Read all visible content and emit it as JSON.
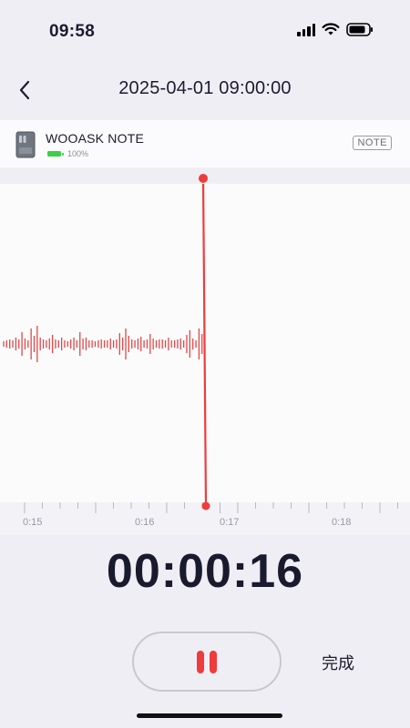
{
  "status_bar": {
    "time": "09:58",
    "signal_icon": "signal-bars-icon",
    "wifi_icon": "wifi-icon",
    "battery_icon": "battery-icon"
  },
  "nav": {
    "back_icon": "chevron-left-icon",
    "title": "2025-04-01 09:00:00"
  },
  "device": {
    "icon": "recorder-device-icon",
    "name": "WOOASK NOTE",
    "battery_percent": "100%",
    "badge": "NOTE"
  },
  "timeline": {
    "labels": [
      "0:15",
      "0:16",
      "0:17",
      "0:18"
    ]
  },
  "timer": "00:00:16",
  "controls": {
    "pause_icon": "pause-icon",
    "done_label": "完成"
  },
  "colors": {
    "accent_red": "#ef3b3b",
    "waveform_red": "#e04848",
    "battery_green": "#3bd048"
  }
}
